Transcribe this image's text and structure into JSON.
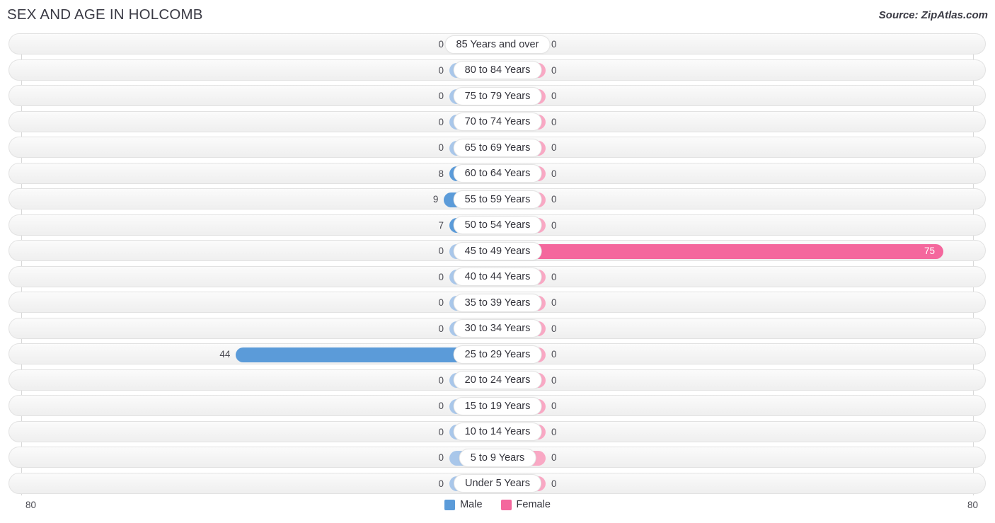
{
  "header": {
    "title": "SEX AND AGE IN HOLCOMB",
    "source": "Source: ZipAtlas.com"
  },
  "legend": {
    "male": {
      "label": "Male",
      "color": "#5b9bd9"
    },
    "female": {
      "label": "Female",
      "color": "#f4679d"
    }
  },
  "axis": {
    "left_label": "80",
    "right_label": "80"
  },
  "colors": {
    "male_light": "#a9c7ea",
    "male_strong": "#5b9bd9",
    "female_light": "#f9a8c4",
    "female_strong": "#f4679d",
    "track": "#f4f4f4",
    "text": "#33333b"
  },
  "chart_data": {
    "type": "bar",
    "title": "SEX AND AGE IN HOLCOMB",
    "subtitle": "",
    "xlabel": "",
    "ylabel": "",
    "orientation": "horizontal",
    "style": "population-pyramid",
    "axis_max": 80,
    "xlim": [
      -80,
      80
    ],
    "grid": false,
    "legend_position": "bottom-center",
    "categories": [
      "85 Years and over",
      "80 to 84 Years",
      "75 to 79 Years",
      "70 to 74 Years",
      "65 to 69 Years",
      "60 to 64 Years",
      "55 to 59 Years",
      "50 to 54 Years",
      "45 to 49 Years",
      "40 to 44 Years",
      "35 to 39 Years",
      "30 to 34 Years",
      "25 to 29 Years",
      "20 to 24 Years",
      "15 to 19 Years",
      "10 to 14 Years",
      "5 to 9 Years",
      "Under 5 Years"
    ],
    "series": [
      {
        "name": "Male",
        "color": "#5b9bd9",
        "values": [
          0,
          0,
          0,
          0,
          0,
          8,
          9,
          7,
          0,
          0,
          0,
          0,
          44,
          0,
          0,
          0,
          0,
          0
        ]
      },
      {
        "name": "Female",
        "color": "#f4679d",
        "values": [
          0,
          0,
          0,
          0,
          0,
          0,
          0,
          0,
          75,
          0,
          0,
          0,
          0,
          0,
          0,
          0,
          0,
          0
        ]
      }
    ]
  },
  "rows": [
    {
      "label": "85 Years and over",
      "male": 0,
      "female": 0
    },
    {
      "label": "80 to 84 Years",
      "male": 0,
      "female": 0
    },
    {
      "label": "75 to 79 Years",
      "male": 0,
      "female": 0
    },
    {
      "label": "70 to 74 Years",
      "male": 0,
      "female": 0
    },
    {
      "label": "65 to 69 Years",
      "male": 0,
      "female": 0
    },
    {
      "label": "60 to 64 Years",
      "male": 8,
      "female": 0
    },
    {
      "label": "55 to 59 Years",
      "male": 9,
      "female": 0
    },
    {
      "label": "50 to 54 Years",
      "male": 7,
      "female": 0
    },
    {
      "label": "45 to 49 Years",
      "male": 0,
      "female": 75
    },
    {
      "label": "40 to 44 Years",
      "male": 0,
      "female": 0
    },
    {
      "label": "35 to 39 Years",
      "male": 0,
      "female": 0
    },
    {
      "label": "30 to 34 Years",
      "male": 0,
      "female": 0
    },
    {
      "label": "25 to 29 Years",
      "male": 44,
      "female": 0
    },
    {
      "label": "20 to 24 Years",
      "male": 0,
      "female": 0
    },
    {
      "label": "15 to 19 Years",
      "male": 0,
      "female": 0
    },
    {
      "label": "10 to 14 Years",
      "male": 0,
      "female": 0
    },
    {
      "label": "5 to 9 Years",
      "male": 0,
      "female": 0
    },
    {
      "label": "Under 5 Years",
      "male": 0,
      "female": 0
    }
  ]
}
